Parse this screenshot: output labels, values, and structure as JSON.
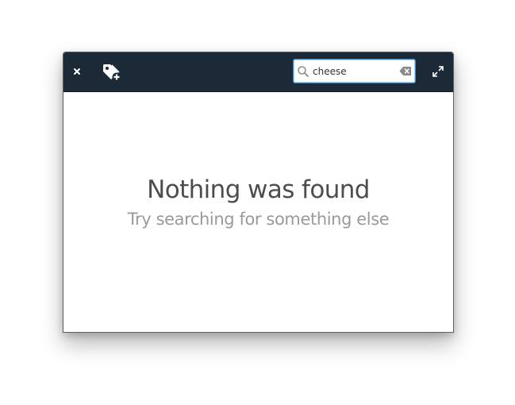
{
  "headerbar": {
    "close_icon": "close-icon",
    "tag_icon": "tag-add-icon",
    "maximize_icon": "maximize-icon",
    "background_color": "#1c2936"
  },
  "search": {
    "value": "cheese",
    "placeholder": "",
    "icon": "search-icon",
    "clear_icon": "clear-text-icon",
    "focus_color": "#3d8fd6"
  },
  "empty_state": {
    "title": "Nothing was found",
    "subtitle": "Try searching for something else"
  }
}
